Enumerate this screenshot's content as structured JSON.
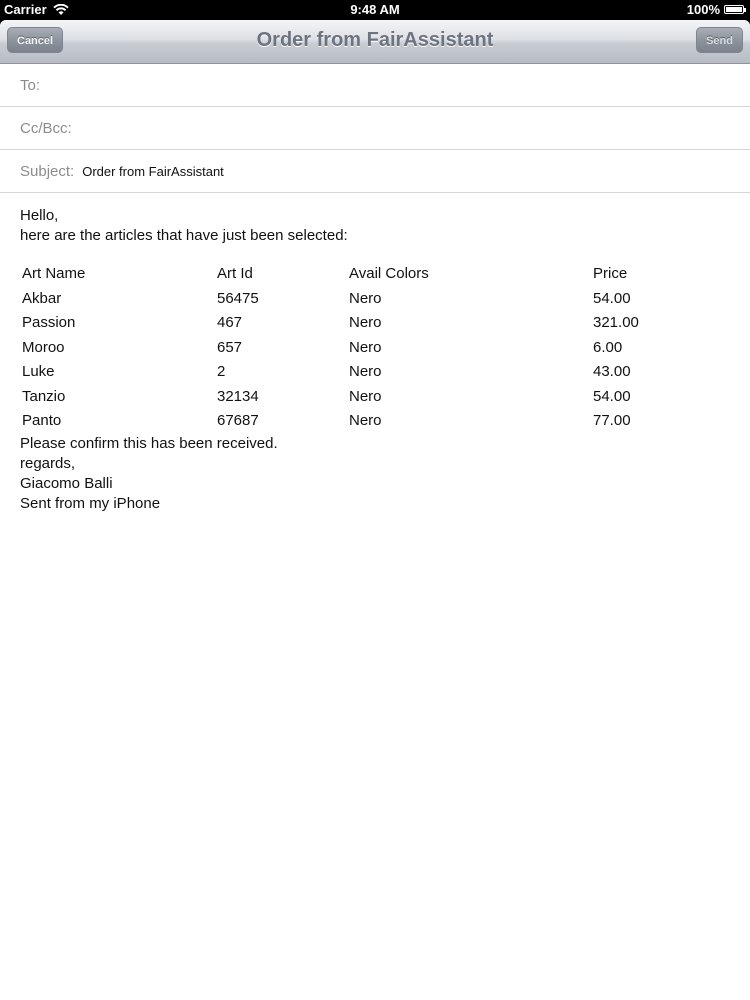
{
  "status_bar": {
    "carrier": "Carrier",
    "time": "9:48 AM",
    "battery": "100%",
    "battery_level": 1.0
  },
  "navbar": {
    "title": "Order from FairAssistant",
    "cancel_label": "Cancel",
    "send_label": "Send"
  },
  "fields": {
    "to_label": "To:",
    "cc_label": "Cc/Bcc:",
    "subject_label": "Subject:",
    "subject_value": "Order from FairAssistant"
  },
  "body": {
    "greeting": "Hello,",
    "intro": "here are the articles that have just been selected:",
    "table": {
      "headers": [
        "Art Name",
        "Art Id",
        "Avail Colors",
        "Price"
      ],
      "rows": [
        [
          "Akbar",
          "56475",
          "Nero",
          "54.00"
        ],
        [
          "Passion",
          "467",
          "Nero",
          "321.00"
        ],
        [
          "Moroo",
          "657",
          "Nero",
          "6.00"
        ],
        [
          "Luke",
          "2",
          "Nero",
          "43.00"
        ],
        [
          "Tanzio",
          "32134",
          "Nero",
          "54.00"
        ],
        [
          "Panto",
          "67687",
          "Nero",
          "77.00"
        ]
      ]
    },
    "confirm": "Please confirm this has been received.",
    "regards": "regards,",
    "name": "Giacomo Balli",
    "signature": "Sent from my iPhone"
  }
}
